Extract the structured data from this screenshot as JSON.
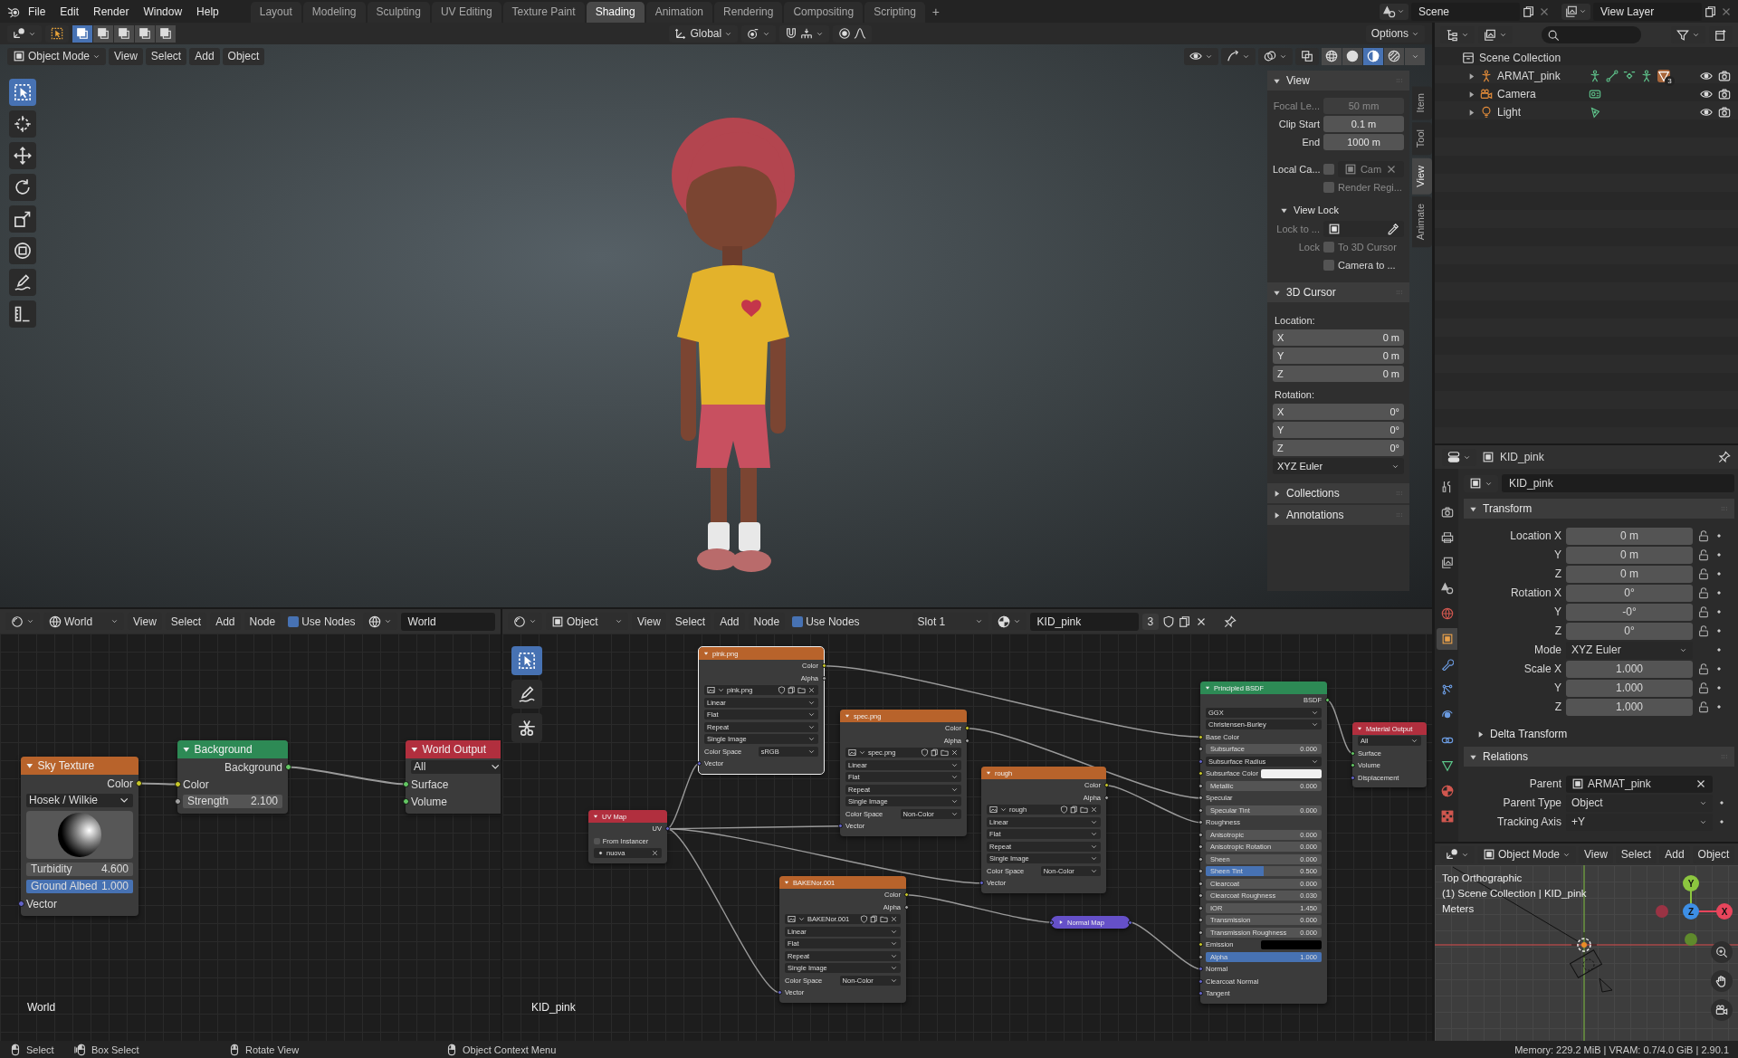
{
  "top_bar": {
    "menus": [
      "File",
      "Edit",
      "Render",
      "Window",
      "Help"
    ],
    "workspaces": [
      {
        "label": "Layout",
        "selected": false
      },
      {
        "label": "Modeling",
        "selected": false
      },
      {
        "label": "Sculpting",
        "selected": false
      },
      {
        "label": "UV Editing",
        "selected": false
      },
      {
        "label": "Texture Paint",
        "selected": false
      },
      {
        "label": "Shading",
        "selected": true
      },
      {
        "label": "Animation",
        "selected": false
      },
      {
        "label": "Rendering",
        "selected": false
      },
      {
        "label": "Compositing",
        "selected": false
      },
      {
        "label": "Scripting",
        "selected": false
      }
    ],
    "add_tab": "+",
    "scene": "Scene",
    "view_layer": "View Layer"
  },
  "viewport": {
    "orientation": "Global",
    "options": "Options",
    "mode": "Object Mode",
    "menus": [
      "View",
      "Select",
      "Add",
      "Object"
    ],
    "select_modes": [
      {
        "selected": true
      },
      {
        "selected": false
      },
      {
        "selected": false
      },
      {
        "selected": false
      },
      {
        "selected": false
      }
    ],
    "shading": [
      {
        "kind": "wireframe",
        "selected": false
      },
      {
        "kind": "solid",
        "selected": false
      },
      {
        "kind": "material",
        "selected": true
      },
      {
        "kind": "rendered",
        "selected": false
      }
    ],
    "tools": [
      {
        "kind": "select",
        "selected": true
      },
      {
        "kind": "cursor",
        "selected": false
      },
      {
        "kind": "move",
        "selected": false
      },
      {
        "kind": "rotate",
        "selected": false
      },
      {
        "kind": "scale",
        "selected": false
      },
      {
        "kind": "transform",
        "selected": false
      },
      {
        "kind": "annotate",
        "selected": false
      },
      {
        "kind": "measure",
        "selected": false
      }
    ],
    "sidebar": {
      "tabs": [
        {
          "label": "Item",
          "selected": false
        },
        {
          "label": "Tool",
          "selected": false
        },
        {
          "label": "View",
          "selected": true
        },
        {
          "label": "Animate",
          "selected": false
        }
      ],
      "sections": [
        {
          "title": "View",
          "expanded": true,
          "rows": [
            {
              "kind": "field",
              "label": "Focal Le...",
              "value": "50 mm",
              "disabled": true
            },
            {
              "kind": "field",
              "label": "Clip Start",
              "value": "0.1 m",
              "disabled": false
            },
            {
              "kind": "field",
              "label": "End",
              "value": "1000 m",
              "disabled": false
            },
            {
              "kind": "camera",
              "label": "Local Ca...",
              "checked": false,
              "value": "Cam",
              "disabled": true
            },
            {
              "kind": "check",
              "label": "Render Regi...",
              "checked": false,
              "disabled": true
            },
            {
              "kind": "subheader",
              "label": "View Lock",
              "expanded": true
            },
            {
              "kind": "picker",
              "label": "Lock to ...",
              "disabled": true
            },
            {
              "kind": "check",
              "row_label": "Lock",
              "label": "To 3D Cursor",
              "checked": false,
              "disabled": true
            },
            {
              "kind": "check",
              "label": "Camera to ...",
              "checked": false,
              "disabled": false
            }
          ]
        },
        {
          "title": "3D Cursor",
          "expanded": true,
          "rows": [
            {
              "kind": "caption",
              "label": "Location:"
            },
            {
              "kind": "axis",
              "label": "X",
              "value": "0 m"
            },
            {
              "kind": "axis",
              "label": "Y",
              "value": "0 m"
            },
            {
              "kind": "axis",
              "label": "Z",
              "value": "0 m"
            },
            {
              "kind": "caption",
              "label": "Rotation:"
            },
            {
              "kind": "axis",
              "label": "X",
              "value": "0°"
            },
            {
              "kind": "axis",
              "label": "Y",
              "value": "0°"
            },
            {
              "kind": "axis",
              "label": "Z",
              "value": "0°"
            },
            {
              "kind": "select",
              "value": "XYZ Euler"
            }
          ]
        },
        {
          "title": "Collections",
          "expanded": false
        },
        {
          "title": "Annotations",
          "expanded": false
        }
      ]
    }
  },
  "world_editor": {
    "data_type": "World",
    "menus": [
      "View",
      "Select",
      "Add",
      "Node"
    ],
    "use_nodes": {
      "label": "Use Nodes",
      "checked": true
    },
    "datablock": "World",
    "label": "World",
    "nodes": [
      {
        "title": "Sky Texture",
        "kind": "texture",
        "selected": false,
        "collapsed": false,
        "rows": [
          {
            "kind": "output",
            "label": "Color",
            "socket": {
              "kind": "color"
            }
          },
          {
            "kind": "select",
            "value": "Hosek / Wilkie"
          },
          {
            "kind": "preview"
          },
          {
            "kind": "field",
            "label": "Turbidity",
            "value": "4.600"
          },
          {
            "kind": "field",
            "label": "Ground Albed",
            "value": "1.000",
            "level": 1
          },
          {
            "kind": "input",
            "label": "Vector",
            "socket": {
              "kind": "vector"
            }
          }
        ]
      },
      {
        "title": "Background",
        "kind": "shader",
        "selected": false,
        "collapsed": false,
        "rows": [
          {
            "kind": "output",
            "label": "Background",
            "socket": {
              "kind": "shader"
            }
          },
          {
            "kind": "input",
            "label": "Color",
            "socket": {
              "kind": "color"
            }
          },
          {
            "kind": "field",
            "label": "Strength",
            "value": "2.100",
            "socket": {
              "kind": "float"
            }
          }
        ]
      },
      {
        "title": "World Output",
        "kind": "output",
        "selected": false,
        "collapsed": false,
        "rows": [
          {
            "kind": "select",
            "value": "All"
          },
          {
            "kind": "input",
            "label": "Surface",
            "socket": {
              "kind": "shader"
            }
          },
          {
            "kind": "input",
            "label": "Volume",
            "socket": {
              "kind": "shader"
            }
          }
        ]
      }
    ]
  },
  "material_editor": {
    "object_type": "Object",
    "menus": [
      "View",
      "Select",
      "Add",
      "Node"
    ],
    "use_nodes": {
      "label": "Use Nodes",
      "checked": true
    },
    "slot": "Slot 1",
    "material": "KID_pink",
    "users": "3",
    "label": "KID_pink",
    "tools": [
      {
        "kind": "select",
        "selected": true
      },
      {
        "kind": "annotate",
        "selected": false
      },
      {
        "kind": "cut",
        "selected": false
      }
    ],
    "nodes": [
      {
        "title": "pink.png",
        "kind": "texture",
        "selected": true,
        "collapsed": false,
        "rows": [
          {
            "kind": "output",
            "label": "Color",
            "socket": {
              "kind": "color"
            }
          },
          {
            "kind": "output",
            "label": "Alpha",
            "socket": {
              "kind": "float"
            }
          },
          {
            "kind": "image",
            "value": "pink.png"
          },
          {
            "kind": "select",
            "value": "Linear"
          },
          {
            "kind": "select",
            "value": "Flat"
          },
          {
            "kind": "select",
            "value": "Repeat"
          },
          {
            "kind": "select",
            "value": "Single Image"
          },
          {
            "kind": "prop_select",
            "label": "Color Space",
            "value": "sRGB"
          },
          {
            "kind": "input",
            "label": "Vector",
            "socket": {
              "kind": "vector"
            }
          }
        ]
      },
      {
        "title": "UV Map",
        "kind": "input",
        "selected": false,
        "collapsed": false,
        "rows": [
          {
            "kind": "output",
            "label": "UV",
            "socket": {
              "kind": "vector"
            }
          },
          {
            "kind": "check",
            "label": "From Instancer",
            "checked": false
          },
          {
            "kind": "datablock",
            "value": "nuova"
          }
        ]
      },
      {
        "title": "spec.png",
        "kind": "texture",
        "selected": false,
        "collapsed": false,
        "rows": [
          {
            "kind": "output",
            "label": "Color",
            "socket": {
              "kind": "color"
            }
          },
          {
            "kind": "output",
            "label": "Alpha",
            "socket": {
              "kind": "float"
            }
          },
          {
            "kind": "image",
            "value": "spec.png"
          },
          {
            "kind": "select",
            "value": "Linear"
          },
          {
            "kind": "select",
            "value": "Flat"
          },
          {
            "kind": "select",
            "value": "Repeat"
          },
          {
            "kind": "select",
            "value": "Single Image"
          },
          {
            "kind": "prop_select",
            "label": "Color Space",
            "value": "Non-Color"
          },
          {
            "kind": "input",
            "label": "Vector",
            "socket": {
              "kind": "vector"
            }
          }
        ]
      },
      {
        "title": "rough",
        "kind": "texture",
        "selected": false,
        "collapsed": false,
        "rows": [
          {
            "kind": "output",
            "label": "Color",
            "socket": {
              "kind": "color"
            }
          },
          {
            "kind": "output",
            "label": "Alpha",
            "socket": {
              "kind": "float"
            }
          },
          {
            "kind": "image",
            "value": "rough"
          },
          {
            "kind": "select",
            "value": "Linear"
          },
          {
            "kind": "select",
            "value": "Flat"
          },
          {
            "kind": "select",
            "value": "Repeat"
          },
          {
            "kind": "select",
            "value": "Single Image"
          },
          {
            "kind": "prop_select",
            "label": "Color Space",
            "value": "Non-Color"
          },
          {
            "kind": "input",
            "label": "Vector",
            "socket": {
              "kind": "vector"
            }
          }
        ]
      },
      {
        "title": "BAKENor.001",
        "kind": "texture",
        "selected": false,
        "collapsed": false,
        "rows": [
          {
            "kind": "output",
            "label": "Color",
            "socket": {
              "kind": "color"
            }
          },
          {
            "kind": "output",
            "label": "Alpha",
            "socket": {
              "kind": "float"
            }
          },
          {
            "kind": "image",
            "value": "BAKENor.001"
          },
          {
            "kind": "select",
            "value": "Linear"
          },
          {
            "kind": "select",
            "value": "Flat"
          },
          {
            "kind": "select",
            "value": "Repeat"
          },
          {
            "kind": "select",
            "value": "Single Image"
          },
          {
            "kind": "prop_select",
            "label": "Color Space",
            "value": "Non-Color"
          },
          {
            "kind": "input",
            "label": "Vector",
            "socket": {
              "kind": "vector"
            }
          }
        ]
      },
      {
        "title": "Normal Map",
        "kind": "vector",
        "selected": false,
        "collapsed": true
      },
      {
        "title": "Principled BSDF",
        "kind": "shader",
        "selected": false,
        "collapsed": false,
        "rows": [
          {
            "kind": "output",
            "label": "BSDF",
            "socket": {
              "kind": "shader"
            }
          },
          {
            "kind": "select",
            "value": "GGX"
          },
          {
            "kind": "select",
            "value": "Christensen-Burley"
          },
          {
            "kind": "input",
            "label": "Base Color",
            "socket": {
              "kind": "color"
            }
          },
          {
            "kind": "field",
            "label": "Subsurface",
            "value": "0.000",
            "socket": {
              "kind": "float"
            }
          },
          {
            "kind": "select",
            "value": "Subsurface Radius",
            "socket": {
              "kind": "vector"
            }
          },
          {
            "kind": "color",
            "label": "Subsurface Color",
            "socket": {
              "kind": "color"
            },
            "color": "#f2f2f2"
          },
          {
            "kind": "field",
            "label": "Metallic",
            "value": "0.000",
            "socket": {
              "kind": "float"
            }
          },
          {
            "kind": "input",
            "label": "Specular",
            "socket": {
              "kind": "float"
            }
          },
          {
            "kind": "field",
            "label": "Specular Tint",
            "value": "0.000",
            "socket": {
              "kind": "float"
            }
          },
          {
            "kind": "input",
            "label": "Roughness",
            "socket": {
              "kind": "float"
            }
          },
          {
            "kind": "field",
            "label": "Anisotropic",
            "value": "0.000",
            "socket": {
              "kind": "float"
            }
          },
          {
            "kind": "field",
            "label": "Anisotropic Rotation",
            "value": "0.000",
            "socket": {
              "kind": "float"
            }
          },
          {
            "kind": "field",
            "label": "Sheen",
            "value": "0.000",
            "socket": {
              "kind": "float"
            }
          },
          {
            "kind": "field",
            "label": "Sheen Tint",
            "value": "0.500",
            "socket": {
              "kind": "float"
            },
            "level": 0.5
          },
          {
            "kind": "field",
            "label": "Clearcoat",
            "value": "0.000",
            "socket": {
              "kind": "float"
            }
          },
          {
            "kind": "field",
            "label": "Clearcoat Roughness",
            "value": "0.030",
            "socket": {
              "kind": "float"
            }
          },
          {
            "kind": "field",
            "label": "IOR",
            "value": "1.450",
            "socket": {
              "kind": "float"
            }
          },
          {
            "kind": "field",
            "label": "Transmission",
            "value": "0.000",
            "socket": {
              "kind": "float"
            }
          },
          {
            "kind": "field",
            "label": "Transmission Roughness",
            "value": "0.000",
            "socket": {
              "kind": "float"
            }
          },
          {
            "kind": "color",
            "label": "Emission",
            "socket": {
              "kind": "color"
            },
            "color": "#000000"
          },
          {
            "kind": "field",
            "label": "Alpha",
            "value": "1.000",
            "socket": {
              "kind": "float"
            },
            "level": 1
          },
          {
            "kind": "input",
            "label": "Normal",
            "socket": {
              "kind": "vector"
            }
          },
          {
            "kind": "input",
            "label": "Clearcoat Normal",
            "socket": {
              "kind": "vector"
            }
          },
          {
            "kind": "input",
            "label": "Tangent",
            "socket": {
              "kind": "vector"
            }
          }
        ]
      },
      {
        "title": "Material Output",
        "kind": "output",
        "selected": false,
        "collapsed": false,
        "rows": [
          {
            "kind": "select",
            "value": "All"
          },
          {
            "kind": "input",
            "label": "Surface",
            "socket": {
              "kind": "shader"
            }
          },
          {
            "kind": "input",
            "label": "Volume",
            "socket": {
              "kind": "shader"
            }
          },
          {
            "kind": "input",
            "label": "Displacement",
            "socket": {
              "kind": "vector"
            }
          }
        ]
      }
    ]
  },
  "outliner": {
    "root": "Scene Collection",
    "items": [
      {
        "name": "ARMAT_pink",
        "kind": "armature",
        "expanded": false,
        "data": [
          {
            "kind": "figure"
          },
          {
            "kind": "bones"
          },
          {
            "kind": "hook"
          },
          {
            "kind": "figure"
          },
          {
            "kind": "mesh",
            "badge": "3"
          }
        ]
      },
      {
        "name": "Camera",
        "kind": "camera",
        "expanded": false,
        "data": [
          {
            "kind": "camera-data"
          }
        ]
      },
      {
        "name": "Light",
        "kind": "light",
        "expanded": false,
        "data": [
          {
            "kind": "light-data"
          }
        ]
      }
    ]
  },
  "properties": {
    "context": "KID_pink",
    "name_field": "KID_pink",
    "tabs": [
      {
        "kind": "tool",
        "selected": false
      },
      {
        "kind": "render",
        "selected": false
      },
      {
        "kind": "output",
        "selected": false
      },
      {
        "kind": "view_layer",
        "selected": false
      },
      {
        "kind": "scene",
        "selected": false
      },
      {
        "kind": "world",
        "selected": false
      },
      {
        "kind": "object",
        "selected": true
      },
      {
        "kind": "modifiers",
        "selected": false
      },
      {
        "kind": "particles",
        "selected": false
      },
      {
        "kind": "physics",
        "selected": false
      },
      {
        "kind": "constraints",
        "selected": false
      },
      {
        "kind": "data",
        "selected": false
      },
      {
        "kind": "material",
        "selected": false
      },
      {
        "kind": "texture",
        "selected": false
      }
    ],
    "sections": [
      {
        "title": "Transform",
        "kind": "panel",
        "expanded": true,
        "rows": [
          {
            "kind": "field",
            "label": "Location X",
            "value": "0 m"
          },
          {
            "kind": "field",
            "label": "Y",
            "value": "0 m"
          },
          {
            "kind": "field",
            "label": "Z",
            "value": "0 m"
          },
          {
            "kind": "field",
            "label": "Rotation X",
            "value": "0°"
          },
          {
            "kind": "field",
            "label": "Y",
            "value": "-0°"
          },
          {
            "kind": "field",
            "label": "Z",
            "value": "0°"
          },
          {
            "kind": "select",
            "label": "Mode",
            "value": "XYZ Euler"
          },
          {
            "kind": "field",
            "label": "Scale X",
            "value": "1.000"
          },
          {
            "kind": "field",
            "label": "Y",
            "value": "1.000"
          },
          {
            "kind": "field",
            "label": "Z",
            "value": "1.000"
          }
        ]
      },
      {
        "title": "Delta Transform",
        "kind": "subpanel",
        "expanded": false
      },
      {
        "title": "Relations",
        "kind": "panel",
        "expanded": true,
        "rows": [
          {
            "kind": "object",
            "label": "Parent",
            "value": "ARMAT_pink"
          },
          {
            "kind": "select",
            "label": "Parent Type",
            "value": "Object"
          },
          {
            "kind": "select",
            "label": "Tracking Axis",
            "value": "+Y"
          }
        ]
      }
    ]
  },
  "mini_viewport": {
    "mode": "Object Mode",
    "menus": [
      "View",
      "Select",
      "Add",
      "Object"
    ],
    "info": [
      "Top Orthographic",
      "(1) Scene Collection | KID_pink",
      "Meters"
    ],
    "gizmo": [
      {
        "label": "Y",
        "color": "#8cc63f"
      },
      {
        "label": "Z",
        "color": "#3d8fe6"
      },
      {
        "label": "X",
        "color": "#e8455c"
      }
    ]
  },
  "status_bar": {
    "hints": [
      {
        "kind": "lmb",
        "label": "Select"
      },
      {
        "kind": "lmb_drag",
        "label": "Box Select"
      },
      {
        "kind": "mmb",
        "label": "Rotate View"
      },
      {
        "kind": "rmb",
        "label": "Object Context Menu"
      }
    ],
    "stats": "Memory: 229.2 MiB | VRAM: 0.7/4.0 GiB | 2.90.1"
  }
}
